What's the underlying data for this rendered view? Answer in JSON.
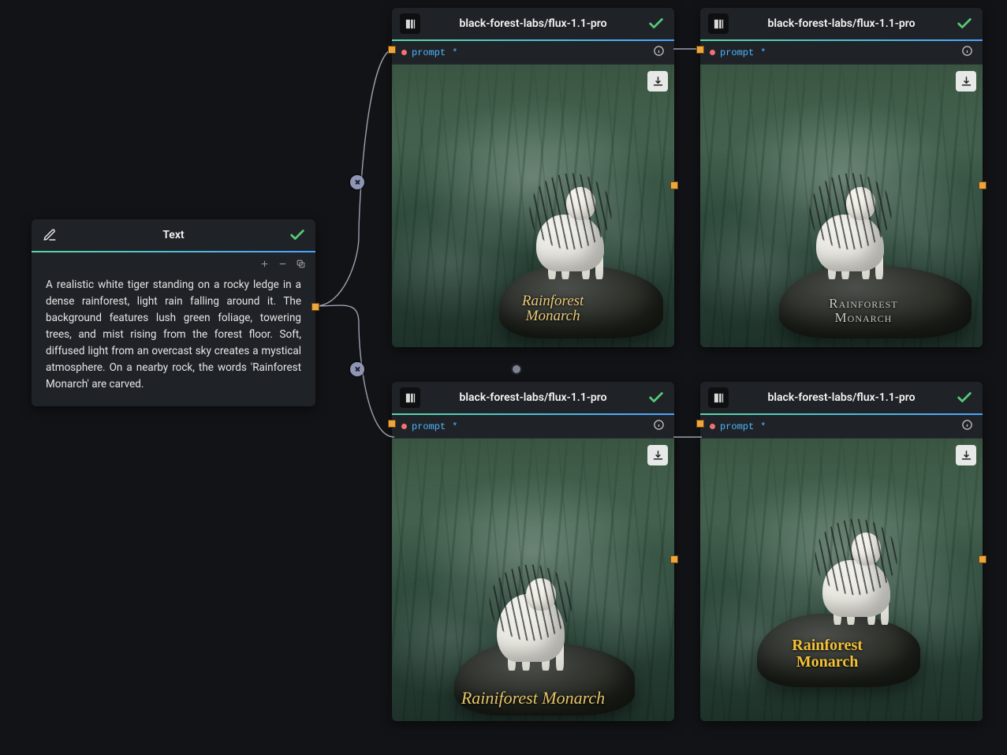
{
  "text_node": {
    "title": "Text",
    "content": "A realistic white tiger standing on a rocky ledge in a dense rainforest, light rain falling around it. The background features lush green foliage, towering trees, and mist rising from the forest floor. Soft, diffused light from an overcast sky creates a mystical atmosphere. On a nearby rock, the words 'Rainforest Monarch' are carved."
  },
  "model_nodes": [
    {
      "title": "black-forest-labs/flux-1.1-pro",
      "prompt_label": "prompt",
      "required_marker": "*",
      "carved_text": "Rainforest\nMonarch",
      "variant": "a"
    },
    {
      "title": "black-forest-labs/flux-1.1-pro",
      "prompt_label": "prompt",
      "required_marker": "*",
      "carved_text": "Rainforest\nMonarch",
      "variant": "b"
    },
    {
      "title": "black-forest-labs/flux-1.1-pro",
      "prompt_label": "prompt",
      "required_marker": "*",
      "carved_text": "Rainiforest Monarch",
      "variant": "c"
    },
    {
      "title": "black-forest-labs/flux-1.1-pro",
      "prompt_label": "prompt",
      "required_marker": "*",
      "carved_text": "Rainforest\nMonarch",
      "variant": "d"
    }
  ]
}
